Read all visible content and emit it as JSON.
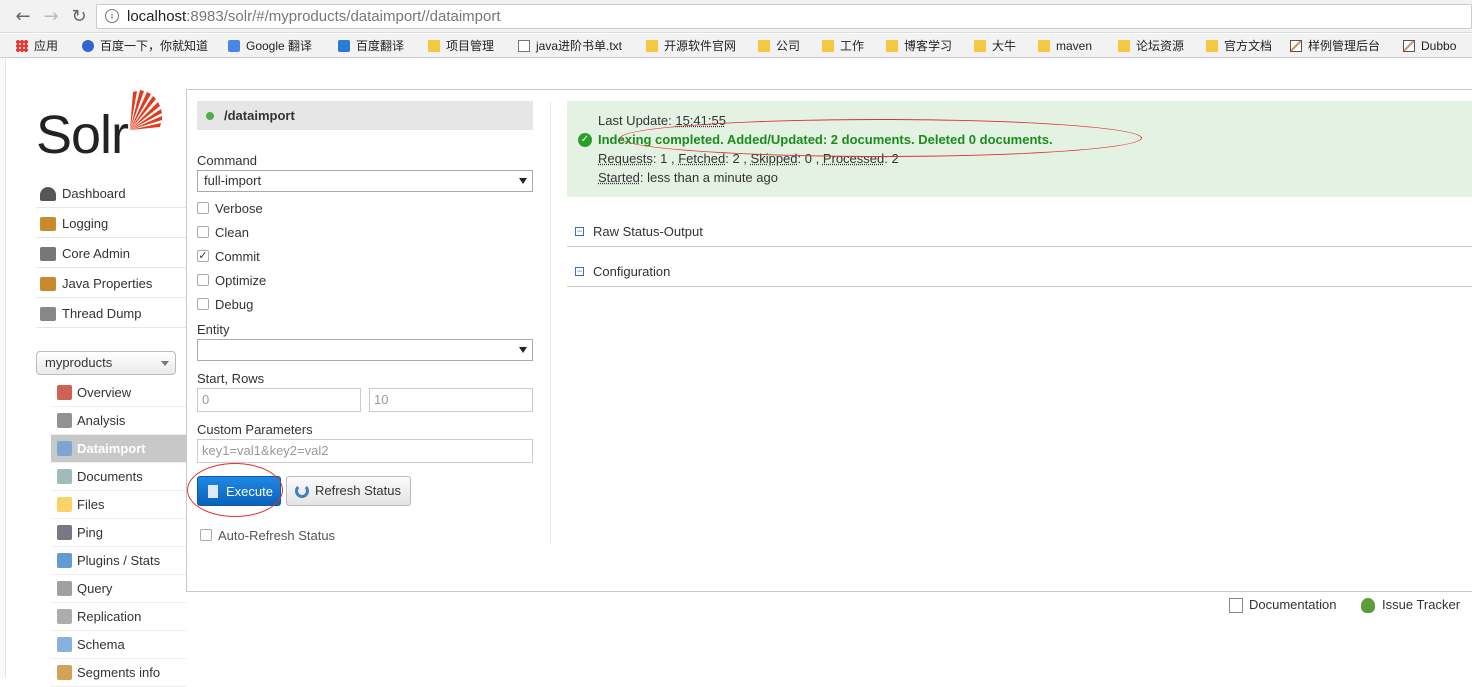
{
  "browser": {
    "url_host": "localhost",
    "url_path": ":8983/solr/#/myproducts/dataimport//dataimport",
    "bookmarks": [
      {
        "label": "应用",
        "icon": "apps-icon"
      },
      {
        "label": "百度一下，你就知道",
        "icon": "baidu-icon"
      },
      {
        "label": "Google 翻译",
        "icon": "google-translate-icon"
      },
      {
        "label": "百度翻译",
        "icon": "translate-icon"
      },
      {
        "label": "项目管理",
        "icon": "folder-icon"
      },
      {
        "label": "java进阶书单.txt",
        "icon": "page-icon"
      },
      {
        "label": "开源软件官网",
        "icon": "folder-icon"
      },
      {
        "label": "公司",
        "icon": "folder-icon"
      },
      {
        "label": "工作",
        "icon": "folder-icon"
      },
      {
        "label": "博客学习",
        "icon": "folder-icon"
      },
      {
        "label": "大牛",
        "icon": "folder-icon"
      },
      {
        "label": "maven",
        "icon": "folder-icon"
      },
      {
        "label": "论坛资源",
        "icon": "folder-icon"
      },
      {
        "label": "官方文档",
        "icon": "folder-icon"
      },
      {
        "label": "样例管理后台",
        "icon": "chart-icon"
      },
      {
        "label": "Dubbo",
        "icon": "chart-icon"
      }
    ]
  },
  "logo": {
    "text": "Solr"
  },
  "nav": {
    "items": [
      {
        "label": "Dashboard",
        "icon": "dashboard-icon"
      },
      {
        "label": "Logging",
        "icon": "logging-icon"
      },
      {
        "label": "Core Admin",
        "icon": "core-admin-icon"
      },
      {
        "label": "Java Properties",
        "icon": "java-icon"
      },
      {
        "label": "Thread Dump",
        "icon": "thread-dump-icon"
      }
    ],
    "core_selected": "myproducts",
    "core_items": [
      {
        "label": "Overview",
        "icon": "home-icon"
      },
      {
        "label": "Analysis",
        "icon": "filter-icon"
      },
      {
        "label": "Dataimport",
        "icon": "dataimport-icon"
      },
      {
        "label": "Documents",
        "icon": "documents-icon"
      },
      {
        "label": "Files",
        "icon": "folder-icon"
      },
      {
        "label": "Ping",
        "icon": "ping-icon"
      },
      {
        "label": "Plugins / Stats",
        "icon": "plugins-icon"
      },
      {
        "label": "Query",
        "icon": "query-icon"
      },
      {
        "label": "Replication",
        "icon": "replication-icon"
      },
      {
        "label": "Schema",
        "icon": "schema-icon"
      },
      {
        "label": "Segments info",
        "icon": "segments-icon"
      }
    ]
  },
  "form": {
    "handler": "/dataimport",
    "command_label": "Command",
    "command_value": "full-import",
    "checkboxes": [
      {
        "label": "Verbose",
        "checked": false
      },
      {
        "label": "Clean",
        "checked": false
      },
      {
        "label": "Commit",
        "checked": true
      },
      {
        "label": "Optimize",
        "checked": false
      },
      {
        "label": "Debug",
        "checked": false
      }
    ],
    "entity_label": "Entity",
    "entity_value": "",
    "start_rows_label": "Start, Rows",
    "start_value": "0",
    "rows_value": "10",
    "custom_params_label": "Custom Parameters",
    "custom_params_value": "key1=val1&key2=val2",
    "execute_label": "Execute",
    "refresh_label": "Refresh Status",
    "auto_refresh_label": "Auto-Refresh Status"
  },
  "status": {
    "last_update_label": "Last Update:",
    "last_update_value": "15:41:55",
    "message": "Indexing completed. Added/Updated: 2 documents. Deleted 0 documents.",
    "requests_label": "Requests",
    "requests_value": "1",
    "fetched_label": "Fetched",
    "fetched_value": "2",
    "skipped_label": "Skipped",
    "skipped_value": "0",
    "processed_label": "Processed",
    "processed_value": "2",
    "started_label": "Started",
    "started_value": "less than a minute ago",
    "raw_status_label": "Raw Status-Output",
    "configuration_label": "Configuration"
  },
  "footer": {
    "documentation": "Documentation",
    "issue_tracker": "Issue Tracker"
  },
  "colors": {
    "success_bg": "#e4f2e4",
    "success_text": "#1a8c1a",
    "execute_blue": "#1e88e5",
    "annotation_red": "#e03030"
  }
}
